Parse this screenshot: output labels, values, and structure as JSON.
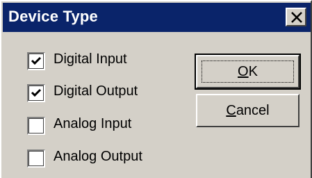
{
  "window": {
    "title": "Device Type"
  },
  "checkboxes": [
    {
      "label": "Digital Input",
      "checked": true
    },
    {
      "label": "Digital Output",
      "checked": true
    },
    {
      "label": "Analog Input",
      "checked": false
    },
    {
      "label": "Analog Output",
      "checked": false
    }
  ],
  "buttons": {
    "ok": {
      "mnemonic": "O",
      "rest": "K"
    },
    "cancel": {
      "mnemonic": "C",
      "rest": "ancel"
    }
  },
  "icons": {
    "close": "close-icon",
    "check": "checkmark-icon"
  },
  "colors": {
    "titlebar": "#0a246a",
    "face": "#d4d0c8"
  }
}
